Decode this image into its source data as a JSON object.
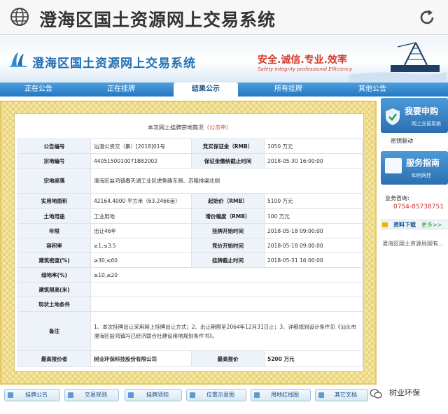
{
  "browser": {
    "title": "澄海区国土资源网上交易系统"
  },
  "banner": {
    "site_title": "澄海区国土资源网上交易系统",
    "slogan": "安全.诚信.专业.效率",
    "slogan_en": "Safety integrity professional Efficiency"
  },
  "nav": {
    "items": [
      "正在公告",
      "正在挂牌",
      "结果公示",
      "所有挂牌",
      "其他公告"
    ],
    "active": "结果公示"
  },
  "content": {
    "caption_prefix": "本次网上挂牌宗地简况",
    "caption_status": "（公示中）",
    "rows": [
      {
        "l1": "公告编号",
        "v1": "汕澄公资交（集）[2018]01号",
        "l2": "竞买保证金（RMB）",
        "v2": "1050 万元"
      },
      {
        "l1": "宗地编号",
        "v1": "4405150010071B82002",
        "l2": "保证金缴纳截止时间",
        "v2": "2018-05-30 16:00:00"
      },
      {
        "l1": "宗地座落",
        "v1": "澄海区盐鸿镇春天湖工业区虎鱼路东侧、苏隆排渠北侧",
        "l2": "",
        "v2": ""
      },
      {
        "l1": "实用地面积",
        "v1": "42164.4000 平方米（63.2466亩）",
        "l2": "起始价（RMB）",
        "v2": "5100 万元"
      },
      {
        "l1": "土地用途",
        "v1": "工业用地",
        "l2": "增价幅度（RMB）",
        "v2": "100 万元"
      },
      {
        "l1": "年限",
        "v1": "出让46年",
        "l2": "挂牌开始时间",
        "v2": "2018-05-18 09:00:00"
      },
      {
        "l1": "容积率",
        "v1": "≥1,≤3.5",
        "l2": "竞价开始时间",
        "v2": "2018-05-18 09:00:00"
      },
      {
        "l1": "建筑密度(%)",
        "v1": "≥30,≤60",
        "l2": "挂牌截止时间",
        "v2": "2018-05-31 16:00:00"
      },
      {
        "l1": "绿地率(%)",
        "v1": "≥10,≤20",
        "l2": "",
        "v2": ""
      },
      {
        "l1": "建筑限高(米)",
        "v1": "",
        "l2": "",
        "v2": ""
      },
      {
        "l1": "现状土地条件",
        "v1": "",
        "l2": "",
        "v2": ""
      }
    ],
    "remarks_label": "备注",
    "remarks": "1、本次挂牌出让采用网上挂牌出让方式；2、出让期限至2064年12月31日止；3、详细规划设计条件见《汕头市澄海区盐鸿镇冯已经济联合社建设用地规划条件书》。",
    "highest_bidder_label": "最高报价者",
    "highest_bidder": "树业环保科技股份有限公司",
    "highest_price_label": "最高报价",
    "highest_price": "5200 万元"
  },
  "sidebar": {
    "apply_title": "我要申购",
    "apply_sub": "网上交易系统",
    "password_link": "密钥驱动",
    "guide_title": "服务指南",
    "guide_sub": "如何网挂",
    "consult_label": "业务咨询:",
    "consult_phone": "0754-85738751",
    "download_title": "资料下载",
    "download_more": "更多>>",
    "download_item": "澄海区国土资源局国有..."
  },
  "bottom": {
    "buttons": [
      "挂牌公告",
      "交易规则",
      "挂牌须知",
      "位置示意图",
      "用地红线图",
      "其它文档"
    ]
  },
  "watermark": "树业环保"
}
